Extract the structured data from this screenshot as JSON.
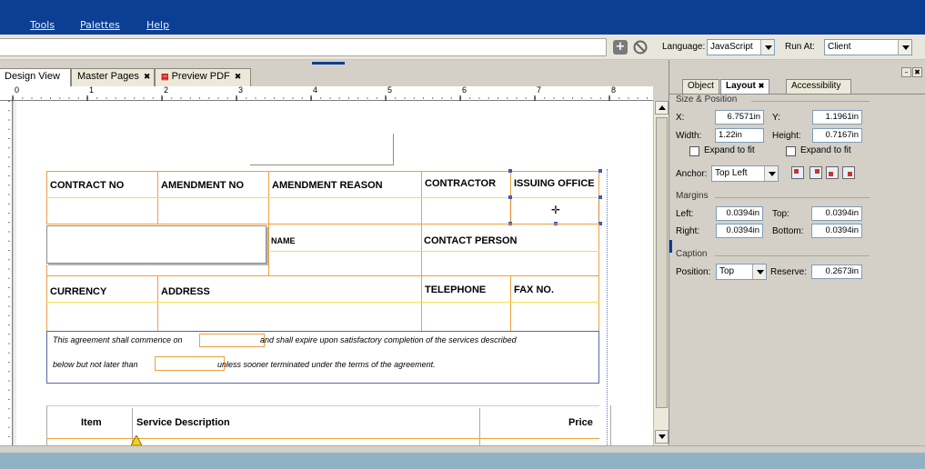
{
  "menu": {
    "items": [
      "Tools",
      "Palettes",
      "Help"
    ]
  },
  "toolbar": {
    "language_label": "Language:",
    "language_value": "JavaScript",
    "runat_label": "Run At:",
    "runat_value": "Client"
  },
  "tabs": [
    {
      "label": "Design View"
    },
    {
      "label": "Master Pages"
    },
    {
      "label": "Preview PDF"
    }
  ],
  "ruler": {
    "marks": [
      "0",
      "1",
      "2",
      "3",
      "4",
      "5",
      "6",
      "7",
      "8"
    ]
  },
  "form": {
    "headers_row1": [
      "CONTRACT NO",
      "AMENDMENT NO",
      "AMENDMENT REASON",
      "CONTRACTOR",
      "ISSUING OFFICE"
    ],
    "name_label": "NAME",
    "contact_person_label": "CONTACT PERSON",
    "headers_row3": [
      "CURRENCY",
      "ADDRESS",
      "TELEPHONE",
      "FAX NO."
    ],
    "agreement_line1a": "This agreement shall commence on",
    "agreement_line1b": "and shall expire upon satisfactory completion of the services described",
    "agreement_line2a": "below but  not later than",
    "agreement_line2b": "unless sooner terminated under the terms of the agreement.",
    "table_headers": {
      "item": "Item",
      "description": "Service Description",
      "price": "Price"
    }
  },
  "panel": {
    "tabs": [
      {
        "label": "Object"
      },
      {
        "label": "Layout"
      },
      {
        "label": "Accessibility"
      }
    ],
    "size_position": {
      "section_label": "Size & Position",
      "x_label": "X:",
      "x_value": "6.7571in",
      "y_label": "Y:",
      "y_value": "1.1961in",
      "width_label": "Width:",
      "width_value": "1.22in",
      "height_label": "Height:",
      "height_value": "0.7167in",
      "expand_label": "Expand to fit"
    },
    "anchor": {
      "label": "Anchor:",
      "value": "Top Left"
    },
    "margins": {
      "section_label": "Margins",
      "left_label": "Left:",
      "left_value": "0.0394in",
      "top_label": "Top:",
      "top_value": "0.0394in",
      "right_label": "Right:",
      "right_value": "0.0394in",
      "bottom_label": "Bottom:",
      "bottom_value": "0.0394in"
    },
    "caption": {
      "section_label": "Caption",
      "position_label": "Position:",
      "position_value": "Top",
      "reserve_label": "Reserve:",
      "reserve_value": "0.2673in"
    }
  }
}
